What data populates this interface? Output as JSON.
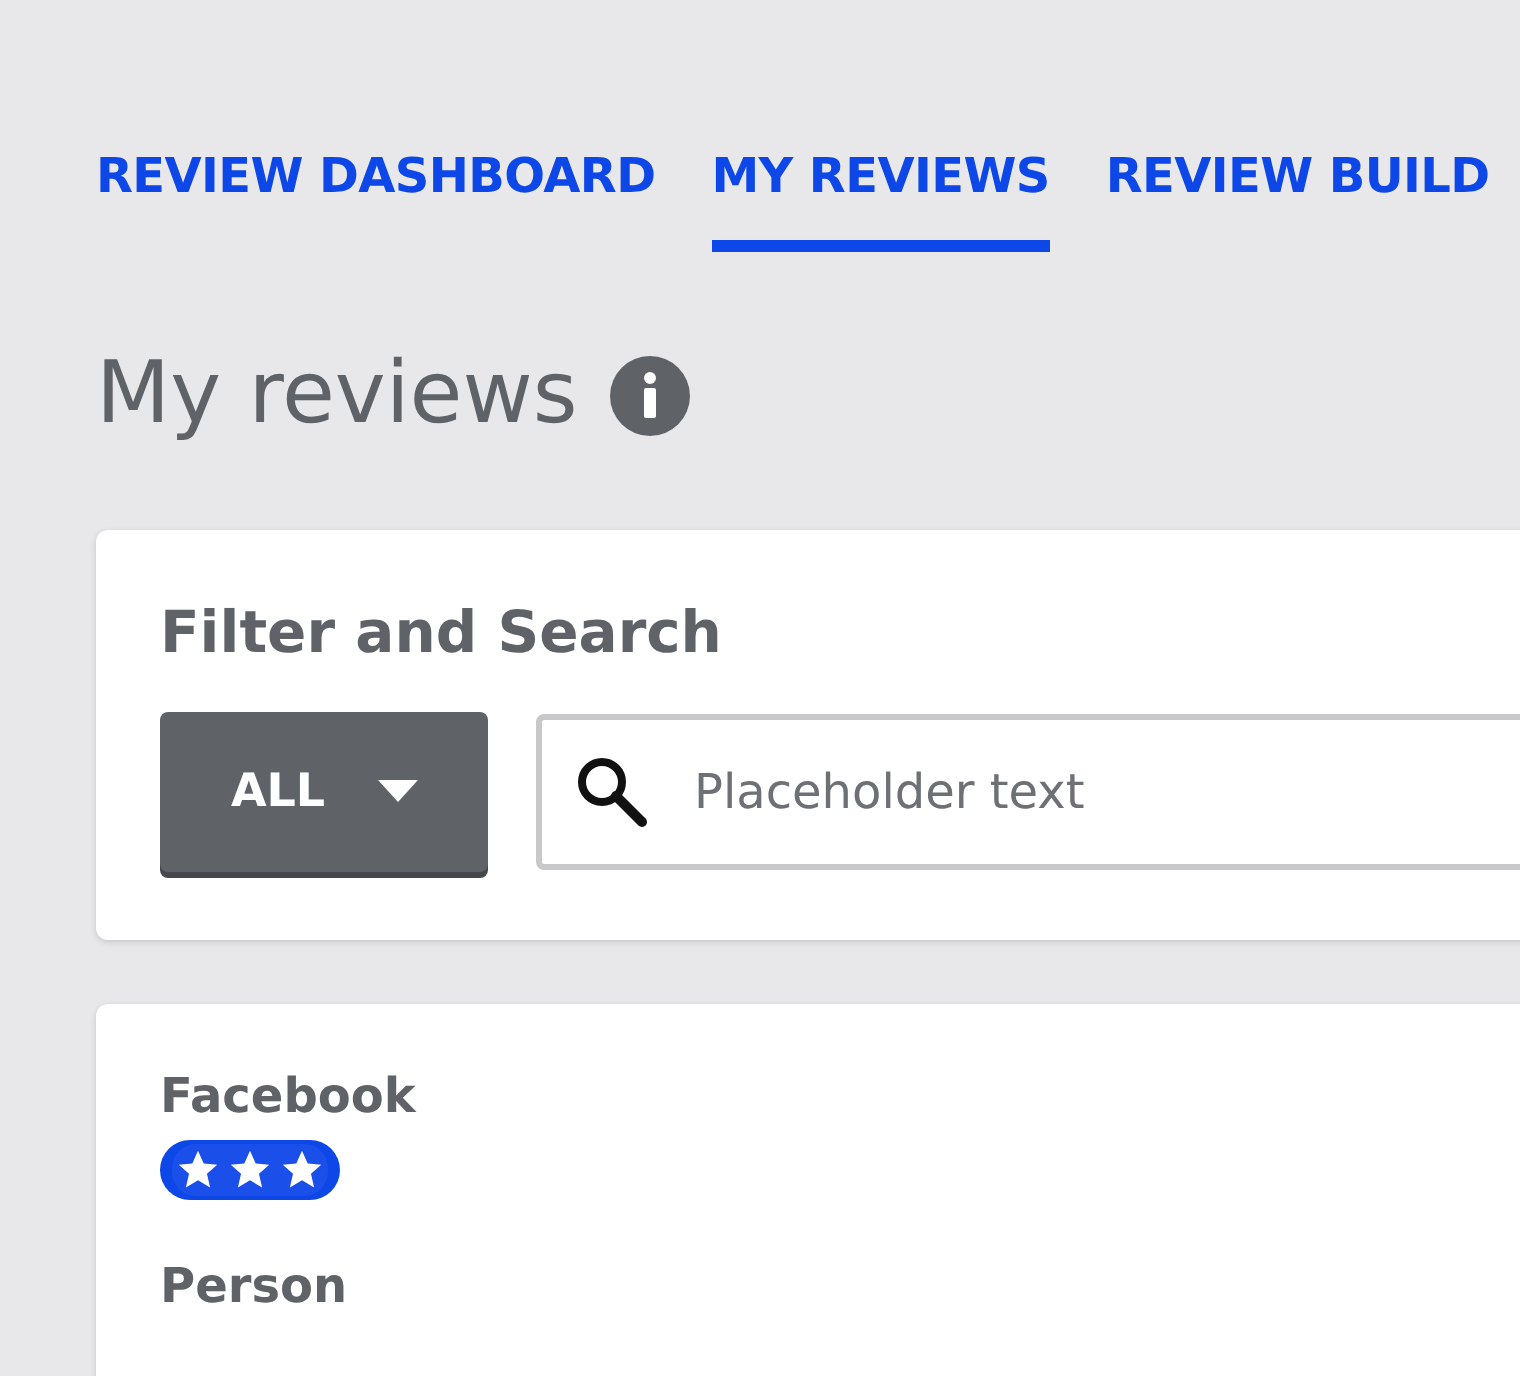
{
  "tabs": [
    {
      "label": "REVIEW DASHBOARD",
      "selected": false
    },
    {
      "label": "MY REVIEWS",
      "selected": true
    },
    {
      "label": "REVIEW BUILD",
      "selected": false
    }
  ],
  "page_title": "My reviews",
  "filter": {
    "title": "Filter and Search",
    "dropdown": "ALL",
    "search": {
      "placeholder": "Placeholder text"
    }
  },
  "review": {
    "source": "Facebook",
    "stars": 3,
    "next_label": "Person"
  }
}
